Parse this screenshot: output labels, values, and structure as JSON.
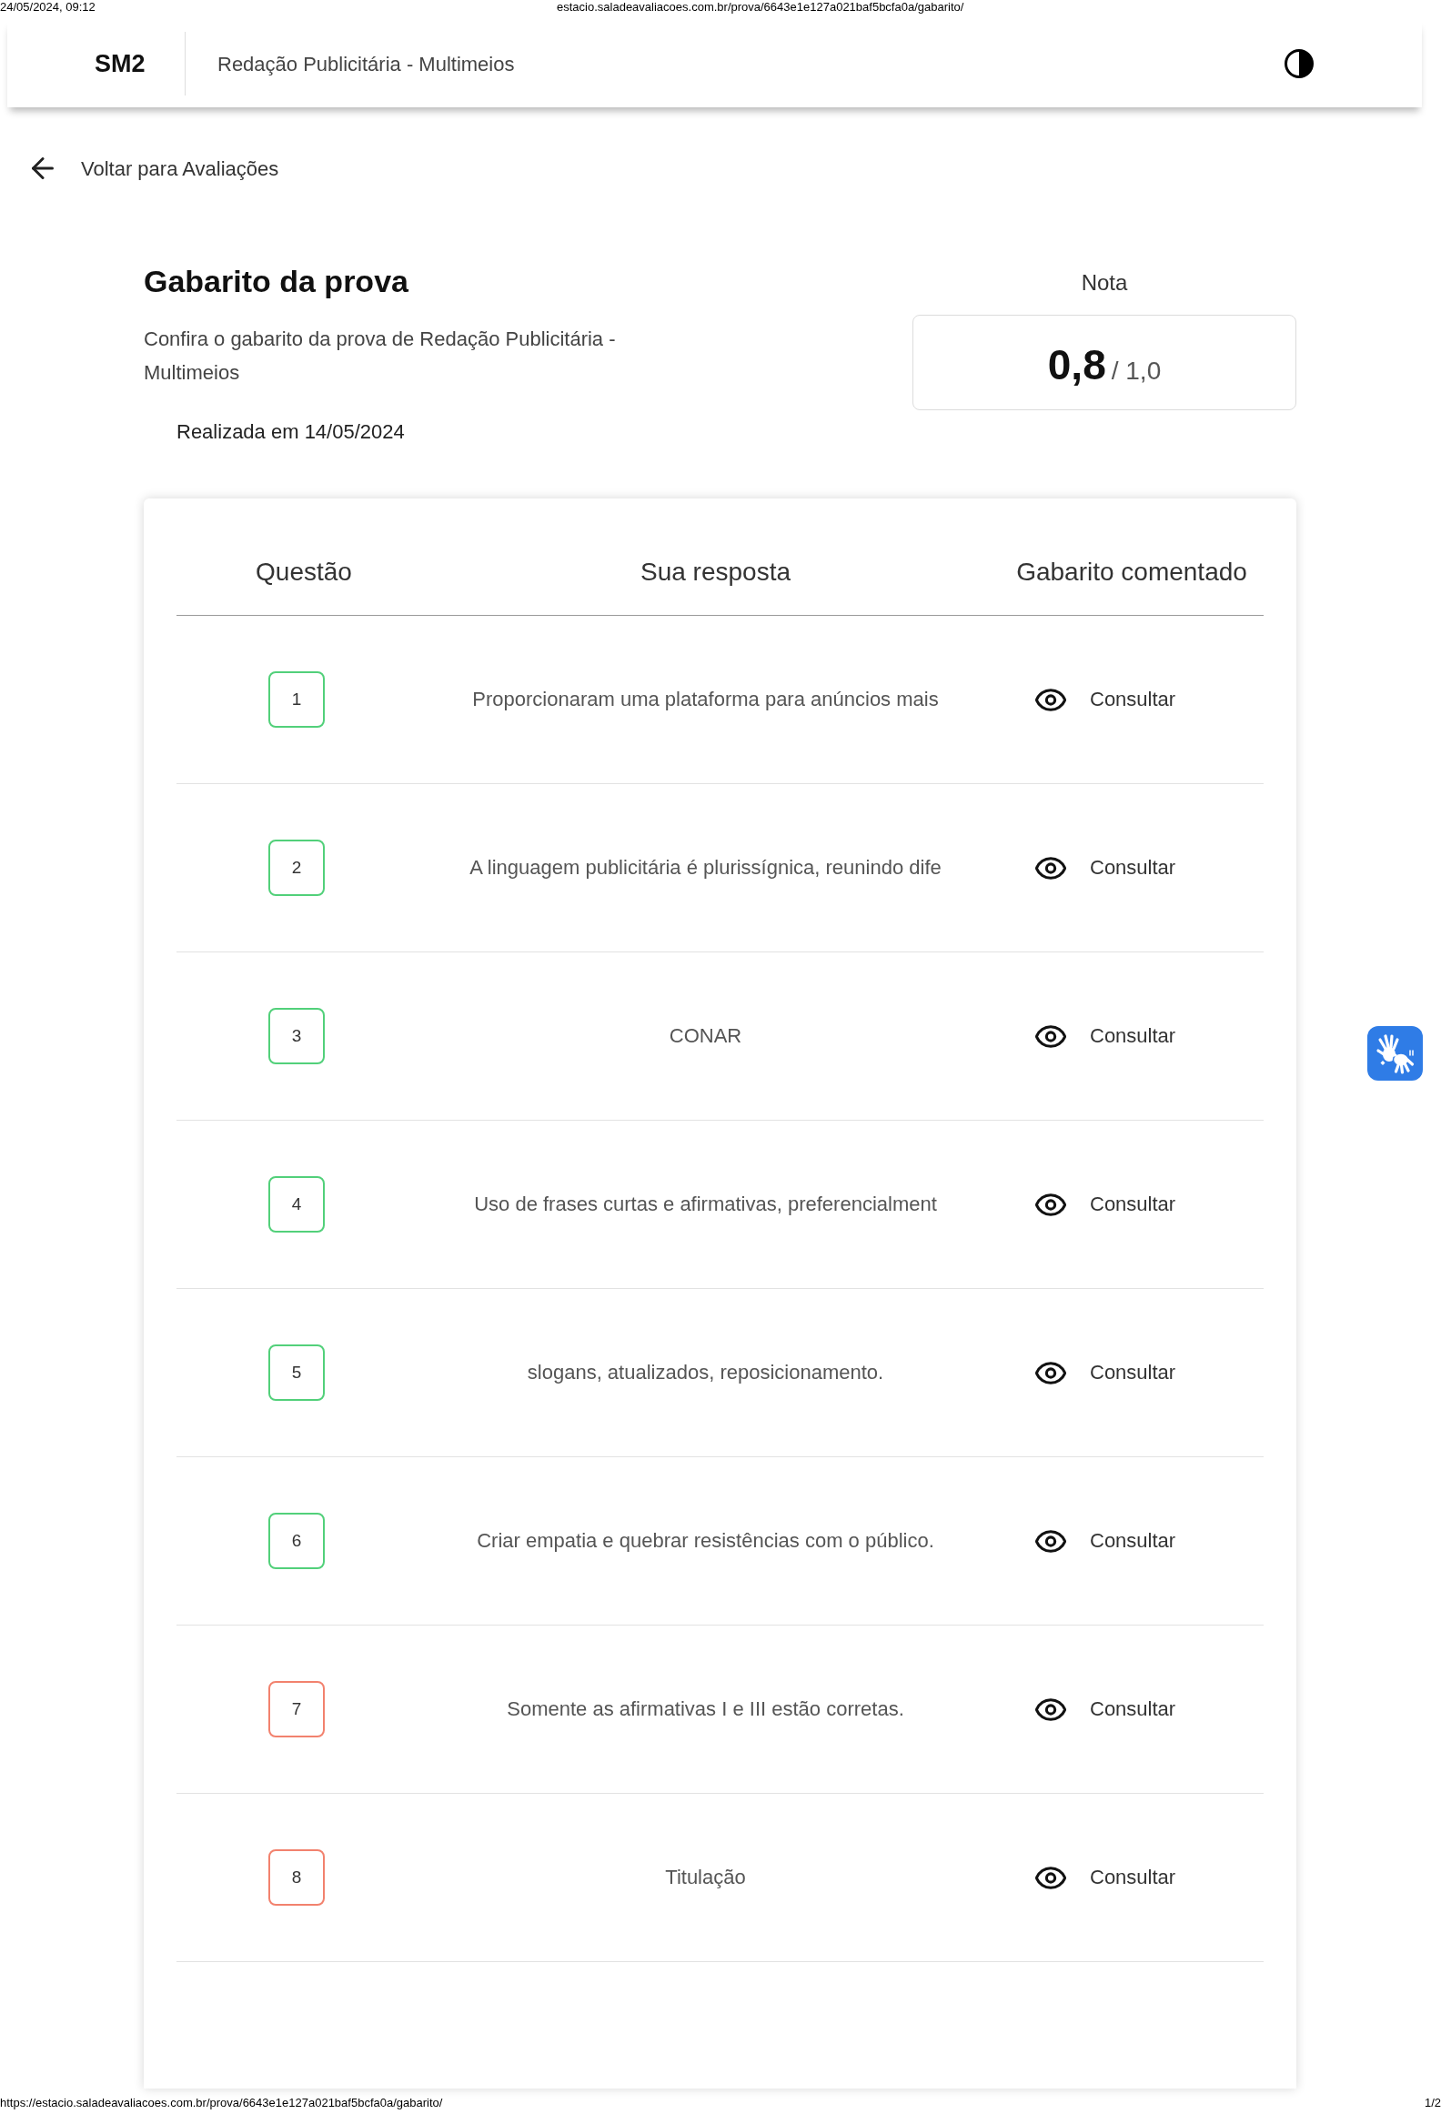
{
  "print_header": {
    "date": "24/05/2024, 09:12",
    "url": "estacio.saladeavaliacoes.com.br/prova/6643e1e127a021baf5bcfa0a/gabarito/"
  },
  "app_bar": {
    "logo": "SM2",
    "course": "Redação Publicitária - Multimeios"
  },
  "back_link": "Voltar para Avaliações",
  "title": "Gabarito da prova",
  "description": "Confira o gabarito da prova de Redação Publicitária - Multimeios",
  "completed": "Realizada em 14/05/2024",
  "grade": {
    "label": "Nota",
    "score": "0,8",
    "total": "/ 1,0"
  },
  "table": {
    "columns": [
      "Questão",
      "Sua resposta",
      "Gabarito comentado"
    ],
    "rows": [
      {
        "number": "1",
        "correct": true,
        "answer": "Proporcionaram uma plataforma para anúncios mais",
        "action": "Consultar"
      },
      {
        "number": "2",
        "correct": true,
        "answer": "A linguagem publicitária é plurissígnica, reunindo dife",
        "action": "Consultar"
      },
      {
        "number": "3",
        "correct": true,
        "answer": "CONAR",
        "action": "Consultar"
      },
      {
        "number": "4",
        "correct": true,
        "answer": "Uso de frases curtas e afirmativas, preferencialment",
        "action": "Consultar"
      },
      {
        "number": "5",
        "correct": true,
        "answer": "slogans, atualizados, reposicionamento.",
        "action": "Consultar"
      },
      {
        "number": "6",
        "correct": true,
        "answer": "Criar empatia e quebrar resistências com o público.",
        "action": "Consultar"
      },
      {
        "number": "7",
        "correct": false,
        "answer": "Somente as afirmativas I e III estão corretas.",
        "action": "Consultar"
      },
      {
        "number": "8",
        "correct": false,
        "answer": "Titulação",
        "action": "Consultar"
      }
    ]
  },
  "print_footer": {
    "url": "https://estacio.saladeavaliacoes.com.br/prova/6643e1e127a021baf5bcfa0a/gabarito/",
    "page": "1/2"
  }
}
